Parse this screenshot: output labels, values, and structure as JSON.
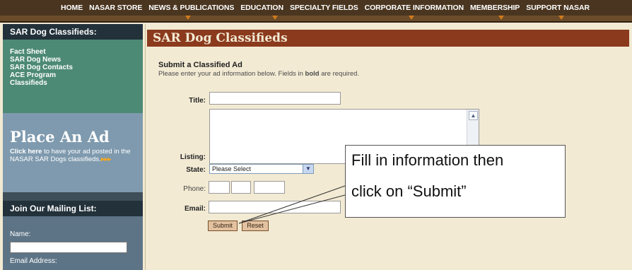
{
  "topnav": {
    "items": [
      "HOME",
      "NASAR STORE",
      "NEWS & PUBLICATIONS",
      "EDUCATION",
      "SPECIALTY FIELDS",
      "CORPORATE INFORMATION",
      "MEMBERSHIP",
      "SUPPORT NASAR"
    ]
  },
  "sidebar": {
    "heading": "SAR Dog Classifieds:",
    "links": [
      "Fact Sheet",
      "SAR Dog News",
      "SAR Dog Contacts",
      "ACE Program",
      "Classifieds"
    ],
    "place_ad": {
      "title": "Place An Ad",
      "click_here": "Click here",
      "desc": "to have your ad posted in the NASAR SAR Dogs classifieds.",
      "arrows": "▸▸▸"
    },
    "mailing": {
      "heading": "Join Our Mailing List:",
      "name_label": "Name:",
      "email_label": "Email Address:"
    }
  },
  "main": {
    "title": "SAR Dog Classifieds",
    "sub_heading": "Submit a Classified Ad",
    "desc_prefix": "Please enter your ad information below. Fields in ",
    "desc_bold": "bold",
    "desc_suffix": " are required.",
    "labels": {
      "title": "Title:",
      "listing": "Listing:",
      "state": "State:",
      "phone": "Phone:",
      "email": "Email:"
    },
    "state_select": "Please Select",
    "buttons": {
      "submit": "Submit",
      "reset": "Reset"
    }
  },
  "callout": {
    "line1": "Fill in information then",
    "line2": "click on “Submit”"
  },
  "colors": {
    "nav_bg": "#4a3620",
    "content_bar": "#8b3a1d",
    "links_green": "#4d8a76",
    "place_ad_blue": "#7f9aae",
    "page_bg": "#f2ead3"
  }
}
